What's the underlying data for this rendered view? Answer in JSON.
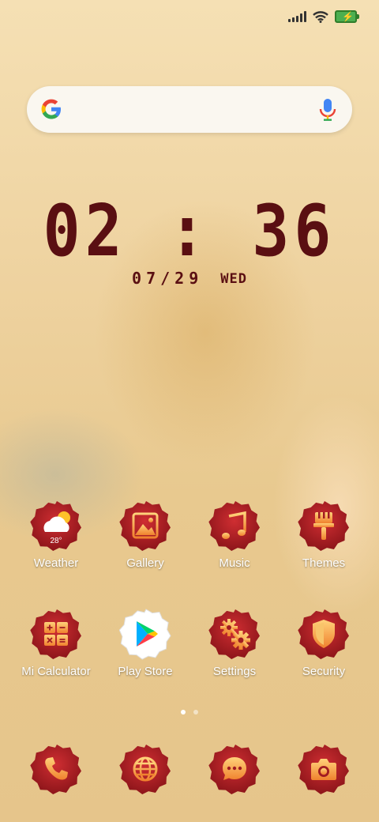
{
  "status": {
    "signal_bars": 5,
    "wifi": "wifi-icon",
    "battery": "charging"
  },
  "search": {
    "left_icon": "google-logo-icon",
    "right_icon": "mic-icon"
  },
  "clock": {
    "time": "02 : 36",
    "date": "07/29",
    "weekday": "WED"
  },
  "apps": [
    {
      "label": "Weather",
      "icon": "weather-icon",
      "temp": "28°"
    },
    {
      "label": "Gallery",
      "icon": "gallery-icon"
    },
    {
      "label": "Music",
      "icon": "music-icon"
    },
    {
      "label": "Themes",
      "icon": "themes-icon"
    },
    {
      "label": "Mi Calculator",
      "icon": "calculator-icon"
    },
    {
      "label": "Play Store",
      "icon": "play-store-icon"
    },
    {
      "label": "Settings",
      "icon": "settings-icon"
    },
    {
      "label": "Security",
      "icon": "security-icon"
    }
  ],
  "pager": {
    "pages": 2,
    "current": 1
  },
  "dock": [
    {
      "name": "phone",
      "icon": "phone-icon"
    },
    {
      "name": "browser",
      "icon": "globe-icon"
    },
    {
      "name": "messages",
      "icon": "message-icon"
    },
    {
      "name": "camera",
      "icon": "camera-icon"
    }
  ],
  "colors": {
    "badge": "#b5232a",
    "badge_dark": "#7e0f14",
    "glyph": "#f6a94a",
    "clock": "#5a0f12"
  }
}
